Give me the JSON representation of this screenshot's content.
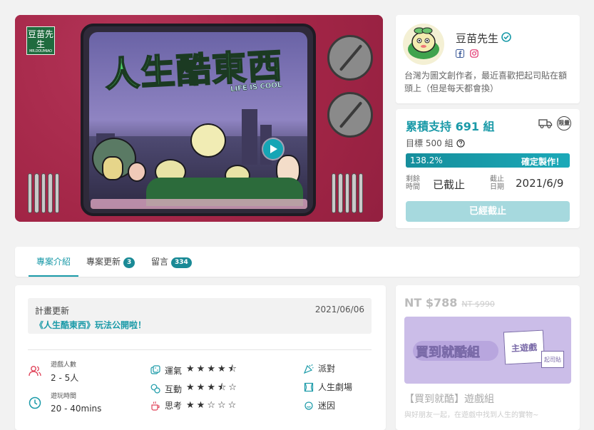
{
  "hero": {
    "logo_text": "豆苗先生",
    "logo_sub": "MR.DOUMIAO",
    "art_title": "人生酷東西",
    "art_subtitle": "LIFE IS COOL",
    "play_icon": "play-icon"
  },
  "creator": {
    "name": "豆苗先生",
    "verified_icon": "verified-check-icon",
    "social": [
      "facebook-icon",
      "instagram-icon"
    ],
    "description": "台灣为圖文創作者，最近喜歡把起司貼在額頭上（但是每天都會換）"
  },
  "funding": {
    "raised_label": "累積支持 691 組",
    "goal_label": "目標 500 組",
    "goal_help_icon": "question-icon",
    "icons": [
      "delivery-truck-icon",
      "limited-badge-icon"
    ],
    "limited_text": "限量",
    "progress_text": "138.2%",
    "progress_fraction": 1.0,
    "confirmed_text": "確定製作！",
    "remaining_label": "剩餘時間",
    "remaining_value": "已截止",
    "deadline_label": "截止日期",
    "deadline_value": "2021/6/9",
    "ended_button": "已經截止",
    "accent": "#1a9aa8"
  },
  "tabs": [
    {
      "label": "專案介紹",
      "count": ""
    },
    {
      "label": "專案更新",
      "count": "3"
    },
    {
      "label": "留言",
      "count": "334"
    }
  ],
  "update": {
    "label": "計畫更新",
    "date": "2021/06/06",
    "title": "《人生酷東西》玩法公開啦！"
  },
  "game_info": {
    "players_label": "遊戲人數",
    "players_value": "2 - 5人",
    "time_label": "遊玩時間",
    "time_value": "20 - 40mins",
    "attributes": [
      {
        "label": "運氣",
        "rating": 4.5
      },
      {
        "label": "互動",
        "rating": 3.5
      },
      {
        "label": "思考",
        "rating": 2
      }
    ],
    "tags": [
      "派對",
      "人生劇場",
      "迷因"
    ]
  },
  "reward": {
    "price": "NT $788",
    "original_price": "NT $990",
    "image_text": "買到就酷組",
    "box_text": "主遊戲",
    "sticker_text": "起司貼",
    "title": "【買到就酷】遊戲組",
    "description": "與好朋友一起，在遊戲中找到人生的實物~"
  }
}
